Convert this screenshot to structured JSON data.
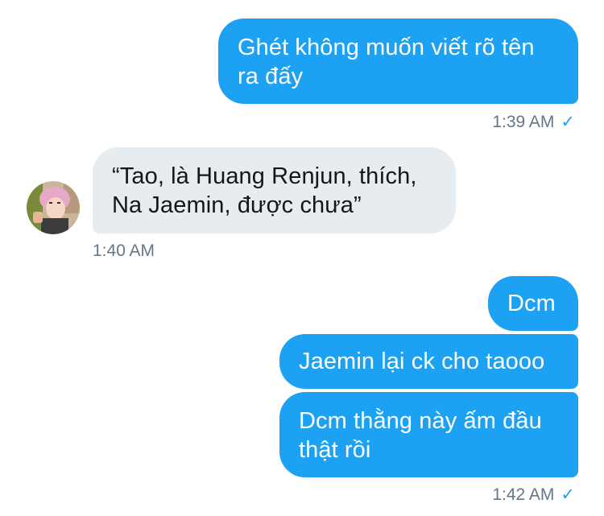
{
  "conversation": {
    "messages": [
      {
        "direction": "outgoing",
        "text": "Ghét không muốn viết rõ tên ra đấy"
      },
      {
        "direction": "incoming",
        "text": "“Tao, là Huang Renjun, thích, Na Jaemin, được chưa”"
      },
      {
        "direction": "outgoing",
        "text": "Dcm"
      },
      {
        "direction": "outgoing",
        "text": "Jaemin lại ck cho taooo"
      },
      {
        "direction": "outgoing",
        "text": "Dcm thằng này ấm đầu thật rồi"
      }
    ],
    "timestamps": [
      "1:39 AM",
      "1:40 AM",
      "1:42 AM"
    ],
    "read_check": "✓"
  },
  "colors": {
    "outgoing_bubble": "#1da1f2",
    "incoming_bubble": "#e6ecf0",
    "timestamp_text": "#657786",
    "check": "#1da1f2"
  },
  "icons": {
    "avatar": "avatar-pink-hair",
    "check": "check-icon"
  }
}
